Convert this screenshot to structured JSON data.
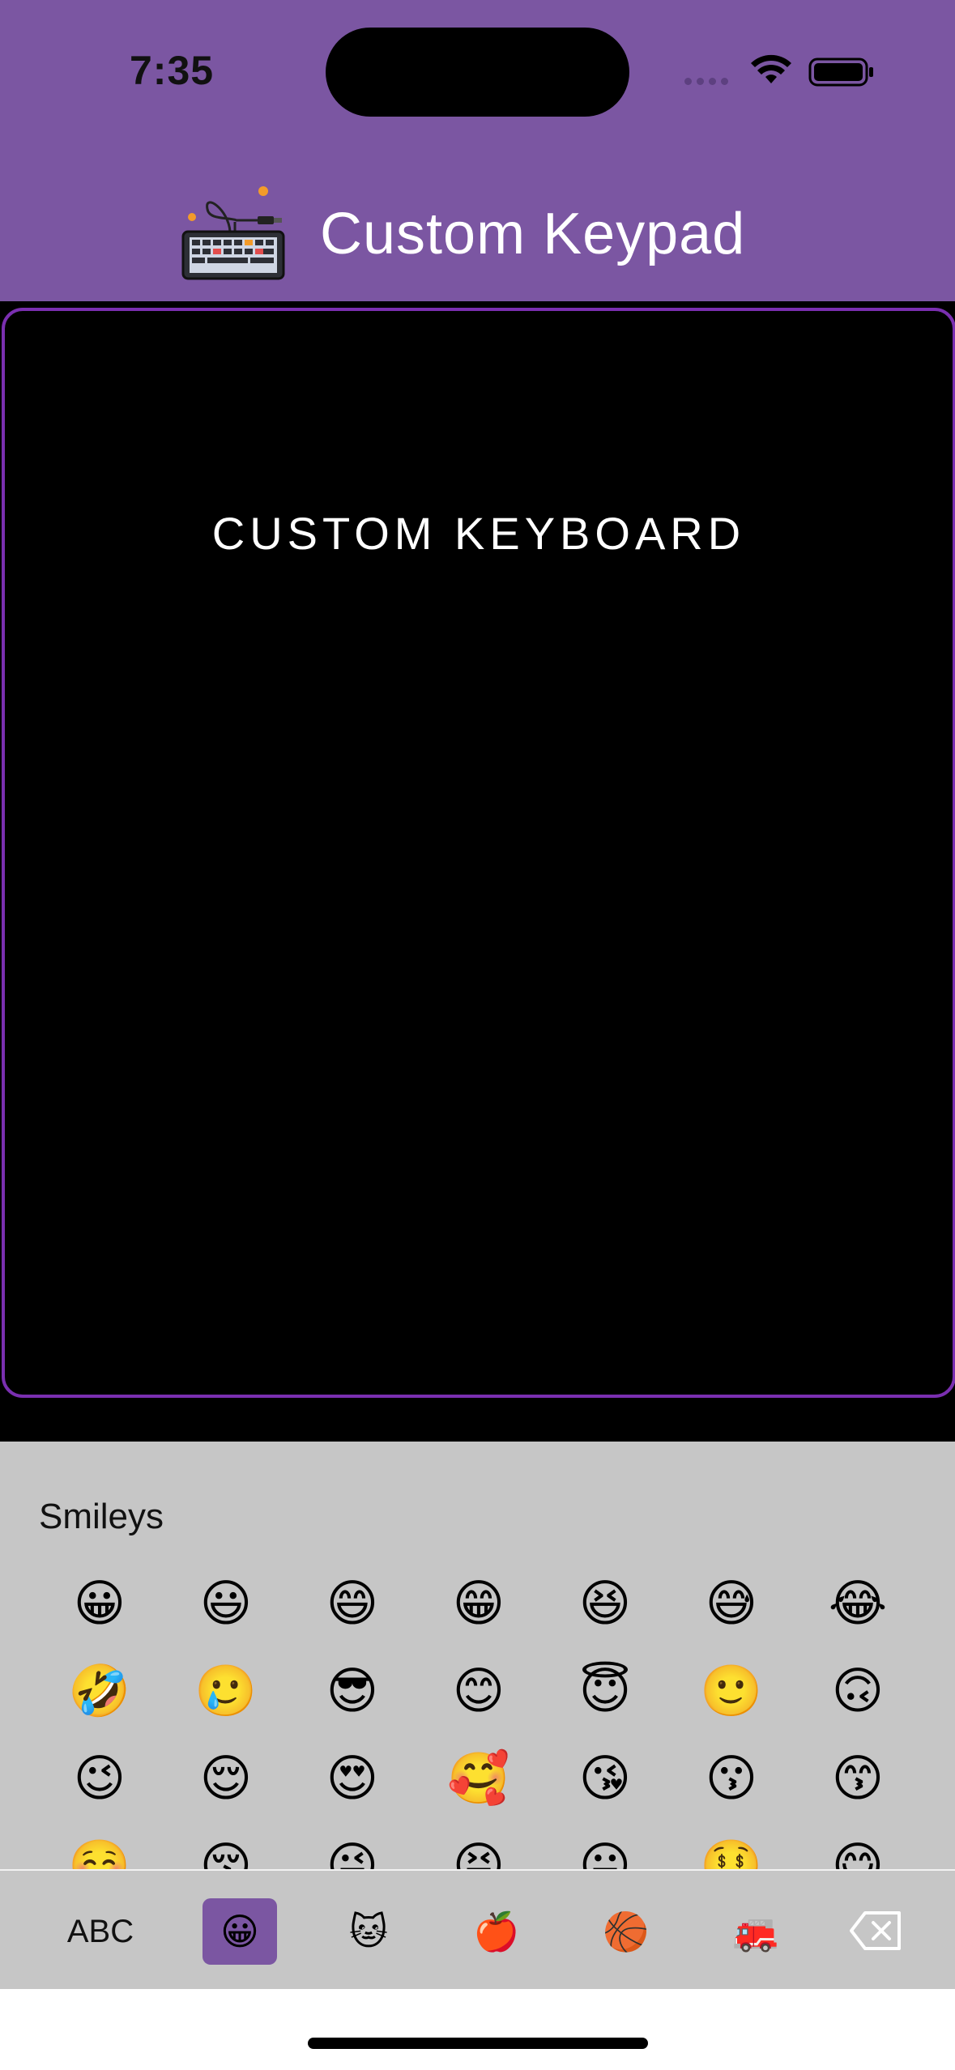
{
  "status": {
    "time": "7:35"
  },
  "header": {
    "title": "Custom Keypad",
    "icon": "keyboard-illustration-icon"
  },
  "display": {
    "rows_top": [
      "😎",
      "😎",
      "😎",
      "😎",
      "😎",
      "😎",
      "😎",
      "😎",
      "😎",
      "😎",
      "😎",
      "😎",
      "😎",
      "😎"
    ],
    "label": "CUSTOM KEYBOARD",
    "rows_bottom": [
      "😍",
      "😍",
      "😍",
      "😍",
      "😍",
      "😍",
      "😍",
      "😍",
      "😍",
      "😍",
      "😍",
      "😍",
      "😍",
      "😍"
    ]
  },
  "keyboard": {
    "category_label": "Smileys",
    "emojis": [
      [
        "😀",
        "😃",
        "😄",
        "😁",
        "😆",
        "😅",
        "😂"
      ],
      [
        "🤣",
        "🥲",
        "😎",
        "😊",
        "😇",
        "🙂",
        "🙃"
      ],
      [
        "😉",
        "😌",
        "😍",
        "🥰",
        "😘",
        "😗",
        "😙"
      ],
      [
        "☺️",
        "😚",
        "😜",
        "😝",
        "😛",
        "🤑",
        "😋"
      ]
    ],
    "tabs": {
      "abc": "ABC",
      "smileys": "😀",
      "animals": "🐱",
      "food": "🍎",
      "activity": "🏀",
      "travel": "🚒"
    }
  },
  "colors": {
    "accent": "#7b56a2",
    "panel_border": "#7a2fb0",
    "keyboard_bg": "#c6c6c6"
  }
}
